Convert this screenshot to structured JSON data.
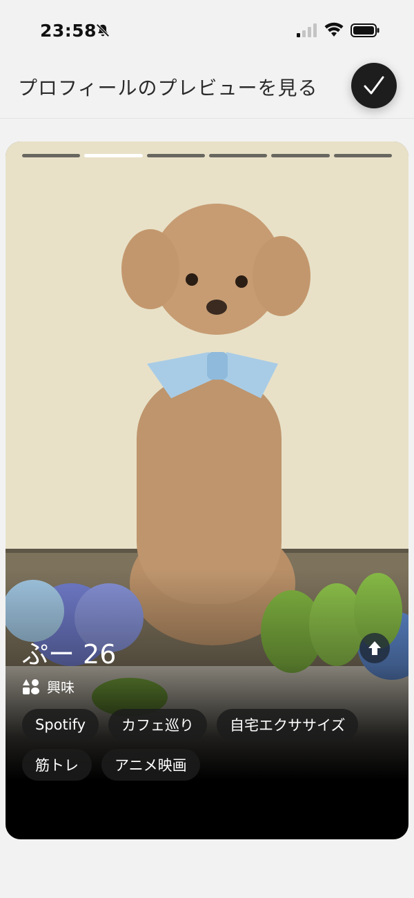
{
  "status": {
    "time": "23:58"
  },
  "header": {
    "title": "プロフィールのプレビューを見る"
  },
  "card": {
    "photo_count": 6,
    "active_photo": 2,
    "name": "ぷー",
    "age": "26",
    "interests_label": "興味",
    "interests": [
      "Spotify",
      "カフェ巡り",
      "自宅エクササイズ",
      "筋トレ",
      "アニメ映画"
    ]
  }
}
